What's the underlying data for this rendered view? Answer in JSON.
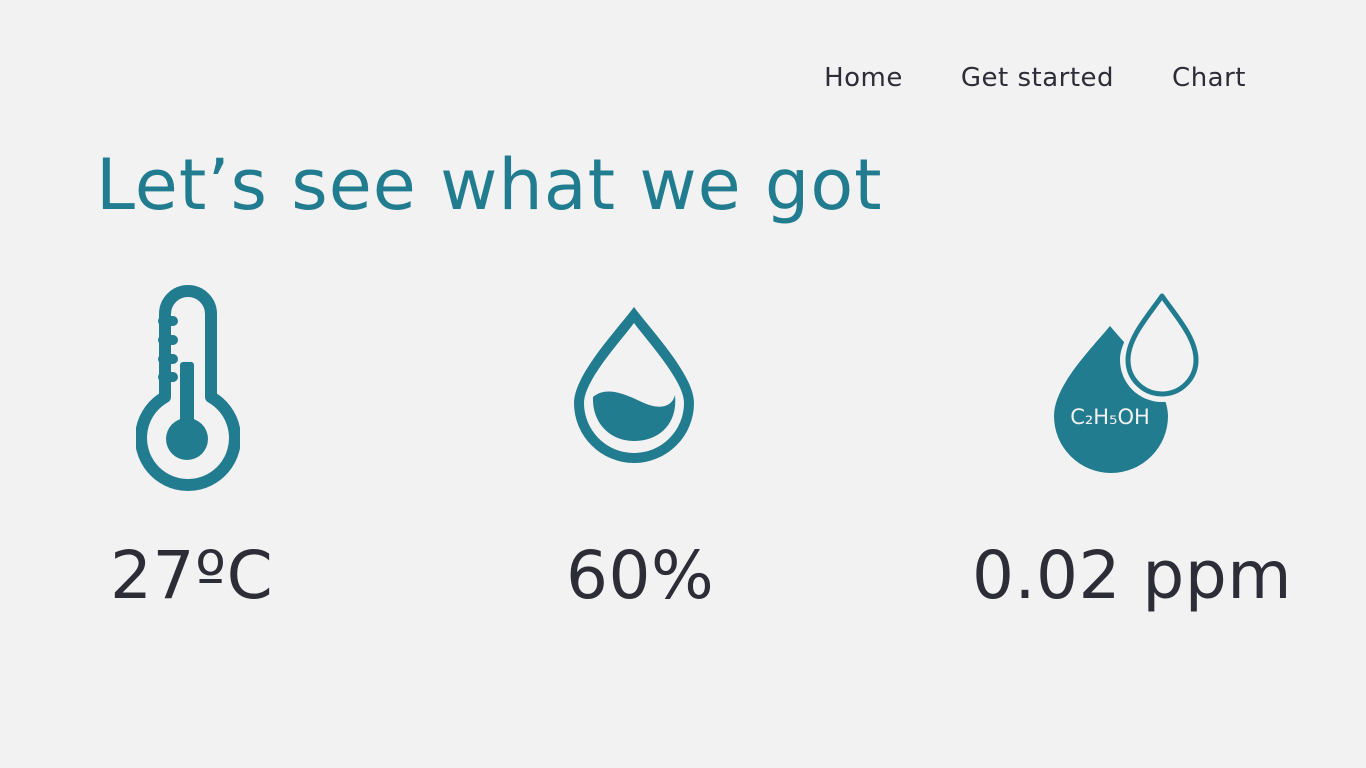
{
  "nav": {
    "items": [
      {
        "label": "Home"
      },
      {
        "label": "Get started"
      },
      {
        "label": "Chart"
      }
    ]
  },
  "heading": "Let’s see what we got",
  "sensors": {
    "temperature": {
      "icon": "thermometer-icon",
      "value": "27ºC"
    },
    "humidity": {
      "icon": "water-drop-icon",
      "value": "60%"
    },
    "alcohol": {
      "icon": "ethanol-drops-icon",
      "formula": "C₂H₅OH",
      "value": "0.02 ppm"
    }
  },
  "colors": {
    "accent": "#217c8f",
    "text": "#2d2d38",
    "background": "#f2f2f2"
  }
}
